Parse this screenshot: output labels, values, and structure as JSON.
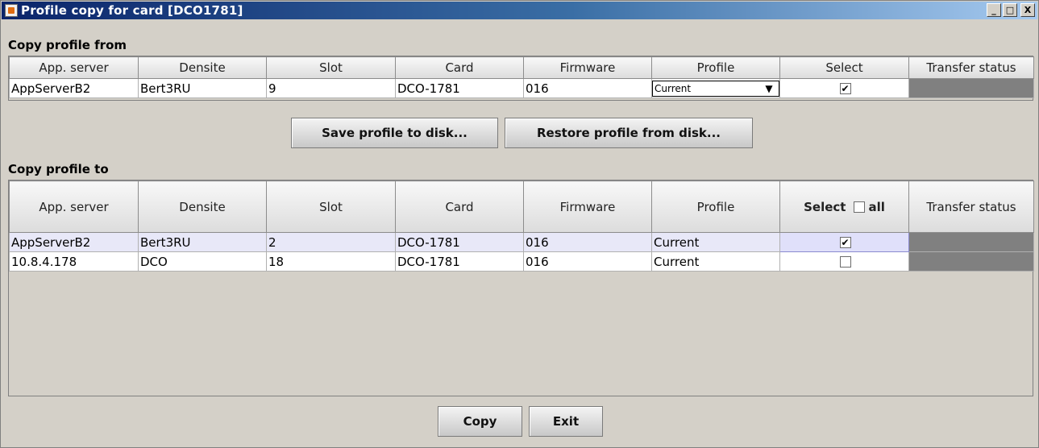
{
  "window": {
    "title": "Profile copy for card [DCO1781]",
    "controls": {
      "minimize": "_",
      "maximize": "□",
      "close": "X"
    }
  },
  "copy_from": {
    "label": "Copy profile from",
    "columns": [
      "App. server",
      "Densite",
      "Slot",
      "Card",
      "Firmware",
      "Profile",
      "Select",
      "Transfer status"
    ],
    "row": {
      "app_server": "AppServerB2",
      "densite": "Bert3RU",
      "slot": "9",
      "card": "DCO-1781",
      "firmware": "016",
      "profile": "Current",
      "selected": true,
      "transfer_status": ""
    }
  },
  "disk_buttons": {
    "save": "Save profile to disk...",
    "restore": "Restore profile from disk..."
  },
  "copy_to": {
    "label": "Copy profile to",
    "columns": [
      "App. server",
      "Densite",
      "Slot",
      "Card",
      "Firmware",
      "Profile",
      "Select",
      "Transfer status"
    ],
    "select_all_label": "all",
    "rows": [
      {
        "app_server": "AppServerB2",
        "densite": "Bert3RU",
        "slot": "2",
        "card": "DCO-1781",
        "firmware": "016",
        "profile": "Current",
        "selected": true,
        "transfer_status": ""
      },
      {
        "app_server": "10.8.4.178",
        "densite": "DCO",
        "slot": "18",
        "card": "DCO-1781",
        "firmware": "016",
        "profile": "Current",
        "selected": false,
        "transfer_status": ""
      }
    ]
  },
  "footer_buttons": {
    "copy": "Copy",
    "exit": "Exit"
  },
  "colors": {
    "title_gradient_start": "#0a246a",
    "title_gradient_end": "#a6caf0",
    "window_bg": "#d4d0c8",
    "status_cell": "#808080",
    "selected_row": "#e8e8f8"
  }
}
